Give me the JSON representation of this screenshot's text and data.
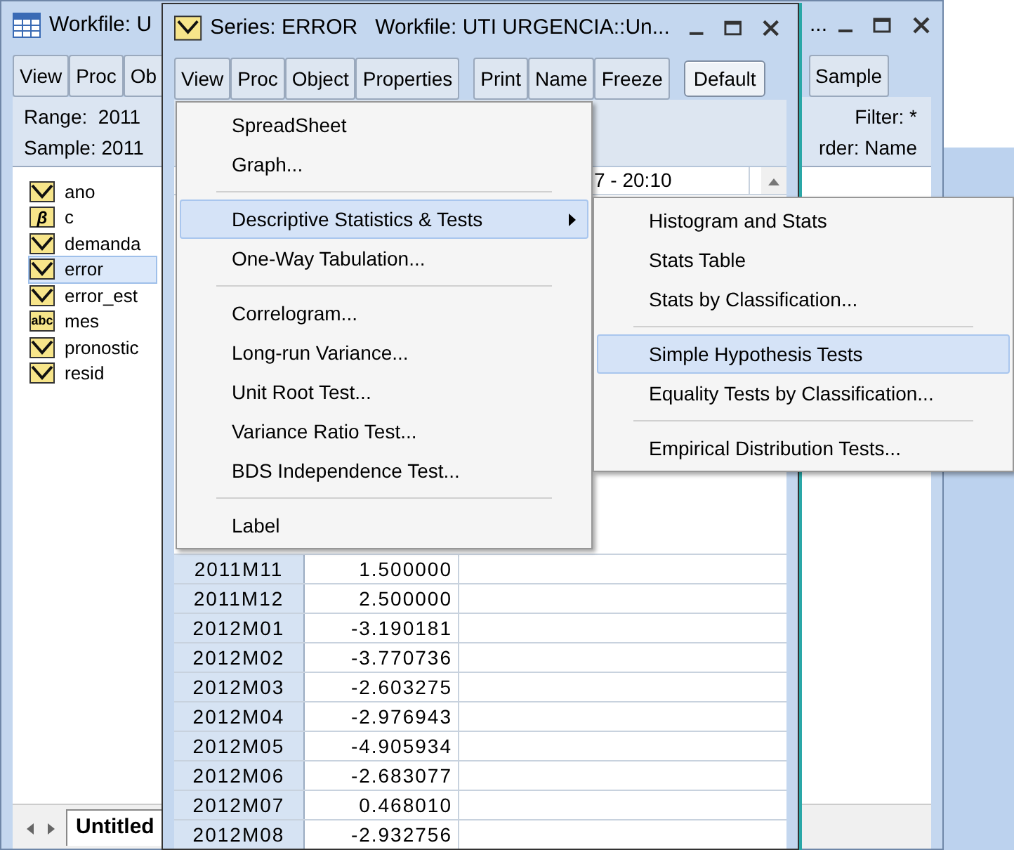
{
  "workfile_window": {
    "title": "Workfile: U",
    "title_right": "...",
    "toolbar": [
      "View",
      "Proc",
      "Ob"
    ],
    "toolbar_right": [
      "Sample"
    ],
    "range": "Range:  2011",
    "sample": "Sample: 2011",
    "filter": "Filter: *",
    "order": "rder: Name",
    "objects": [
      {
        "name": "ano",
        "kind": "series",
        "selected": false
      },
      {
        "name": "c",
        "kind": "coef",
        "badge": "β",
        "selected": false
      },
      {
        "name": "demanda",
        "kind": "series",
        "selected": false
      },
      {
        "name": "error",
        "kind": "series",
        "selected": true
      },
      {
        "name": "error_est",
        "kind": "series",
        "selected": false
      },
      {
        "name": "mes",
        "kind": "alpha",
        "badge": "abc",
        "selected": false
      },
      {
        "name": "pronostic",
        "kind": "series",
        "selected": false
      },
      {
        "name": "resid",
        "kind": "series",
        "selected": false
      }
    ],
    "sheet_tabs": [
      {
        "label": "Untitled",
        "selected": true
      }
    ]
  },
  "series_window": {
    "title": "Series: ERROR   Workfile: UTI URGENCIA::Un...",
    "toolbar": [
      {
        "kind": "segment",
        "label": "View"
      },
      {
        "kind": "segment",
        "label": "Proc"
      },
      {
        "kind": "segment",
        "label": "Object"
      },
      {
        "kind": "segment",
        "label": "Properties"
      },
      {
        "kind": "gap"
      },
      {
        "kind": "segment",
        "label": "Print"
      },
      {
        "kind": "segment",
        "label": "Name"
      },
      {
        "kind": "segment",
        "label": "Freeze"
      },
      {
        "kind": "gap"
      },
      {
        "kind": "button",
        "label": "Default"
      }
    ],
    "header_text": "7 - 20:10",
    "rows": [
      {
        "date": "2011M11",
        "value": "1.500000"
      },
      {
        "date": "2011M12",
        "value": "2.500000"
      },
      {
        "date": "2012M01",
        "value": "-3.190181"
      },
      {
        "date": "2012M02",
        "value": "-3.770736"
      },
      {
        "date": "2012M03",
        "value": "-2.603275"
      },
      {
        "date": "2012M04",
        "value": "-2.976943"
      },
      {
        "date": "2012M05",
        "value": "-4.905934"
      },
      {
        "date": "2012M06",
        "value": "-2.683077"
      },
      {
        "date": "2012M07",
        "value": "0.468010"
      },
      {
        "date": "2012M08",
        "value": "-2.932756"
      }
    ]
  },
  "menu": {
    "items": [
      {
        "kind": "item",
        "label": "SpreadSheet",
        "selected": false,
        "submenu": false
      },
      {
        "kind": "item",
        "label": "Graph...",
        "selected": false,
        "submenu": false
      },
      {
        "kind": "separator"
      },
      {
        "kind": "item",
        "label": "Descriptive Statistics & Tests",
        "selected": true,
        "submenu": true
      },
      {
        "kind": "item",
        "label": "One-Way Tabulation...",
        "selected": false,
        "submenu": false
      },
      {
        "kind": "separator"
      },
      {
        "kind": "item",
        "label": "Correlogram...",
        "selected": false,
        "submenu": false
      },
      {
        "kind": "item",
        "label": "Long-run Variance...",
        "selected": false,
        "submenu": false
      },
      {
        "kind": "item",
        "label": "Unit Root Test...",
        "selected": false,
        "submenu": false
      },
      {
        "kind": "item",
        "label": "Variance Ratio Test...",
        "selected": false,
        "submenu": false
      },
      {
        "kind": "item",
        "label": "BDS Independence Test...",
        "selected": false,
        "submenu": false
      },
      {
        "kind": "separator"
      },
      {
        "kind": "item",
        "label": "Label",
        "selected": false,
        "submenu": false
      }
    ]
  },
  "submenu": {
    "items": [
      {
        "kind": "item",
        "label": "Histogram and Stats",
        "selected": false
      },
      {
        "kind": "item",
        "label": "Stats Table",
        "selected": false
      },
      {
        "kind": "item",
        "label": "Stats by Classification...",
        "selected": false
      },
      {
        "kind": "separator"
      },
      {
        "kind": "item",
        "label": "Simple Hypothesis Tests",
        "selected": true
      },
      {
        "kind": "item",
        "label": "Equality Tests by Classification...",
        "selected": false
      },
      {
        "kind": "separator"
      },
      {
        "kind": "item",
        "label": "Empirical Distribution Tests...",
        "selected": false
      }
    ]
  }
}
